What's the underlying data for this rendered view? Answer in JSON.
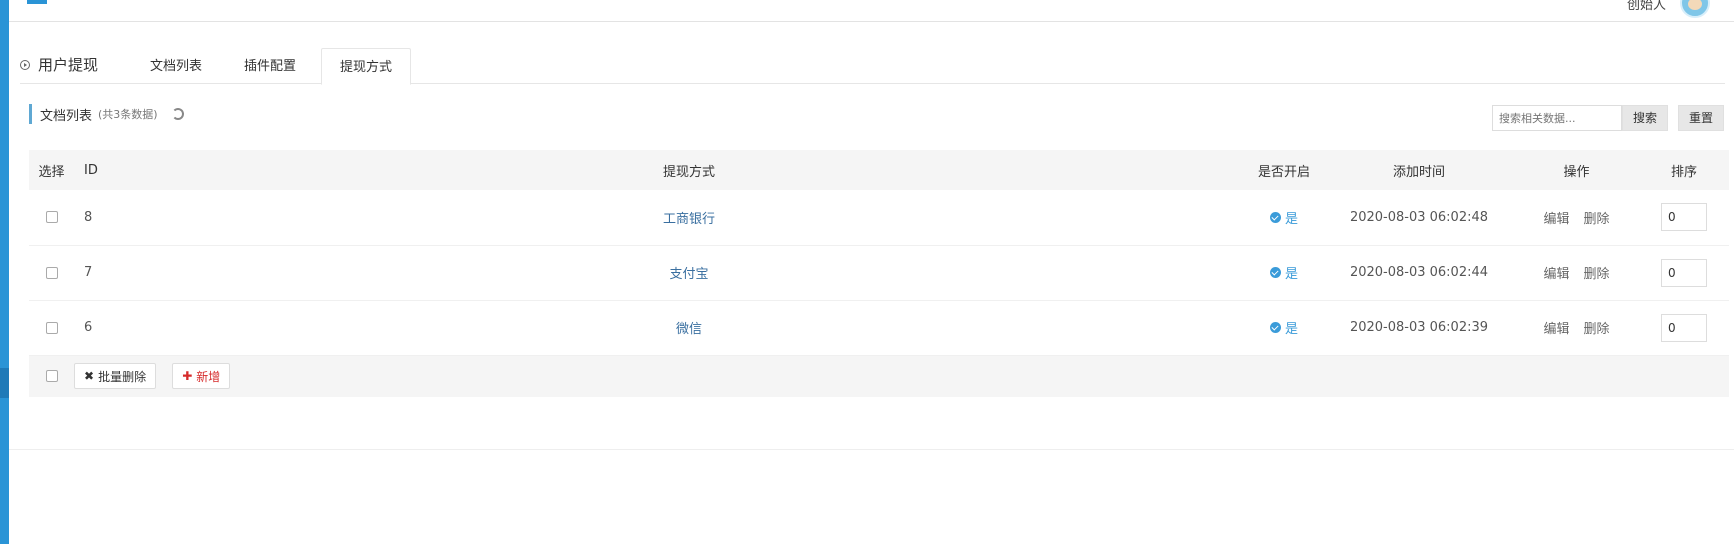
{
  "header": {
    "user_name": "创始人"
  },
  "tabs": {
    "title": "用户提现",
    "items": [
      {
        "label": "文档列表"
      },
      {
        "label": "插件配置"
      },
      {
        "label": "提现方式"
      }
    ]
  },
  "section": {
    "title": "文档列表",
    "count": "(共3条数据)"
  },
  "search": {
    "placeholder": "搜索相关数据...",
    "search_label": "搜索",
    "reset_label": "重置"
  },
  "table": {
    "headers": {
      "select": "选择",
      "id": "ID",
      "method": "提现方式",
      "enabled": "是否开启",
      "time": "添加时间",
      "ops": "操作",
      "sort": "排序"
    },
    "rows": [
      {
        "id": "8",
        "method": "工商银行",
        "enabled": "是",
        "time": "2020-08-03 06:02:48",
        "edit": "编辑",
        "delete": "删除",
        "sort": "0"
      },
      {
        "id": "7",
        "method": "支付宝",
        "enabled": "是",
        "time": "2020-08-03 06:02:44",
        "edit": "编辑",
        "delete": "删除",
        "sort": "0"
      },
      {
        "id": "6",
        "method": "微信",
        "enabled": "是",
        "time": "2020-08-03 06:02:39",
        "edit": "编辑",
        "delete": "删除",
        "sort": "0"
      }
    ]
  },
  "footer": {
    "batch_delete": "批量删除",
    "add_new": "新增"
  },
  "colors": {
    "accent": "#2a94d6",
    "danger": "#d62b2b"
  }
}
